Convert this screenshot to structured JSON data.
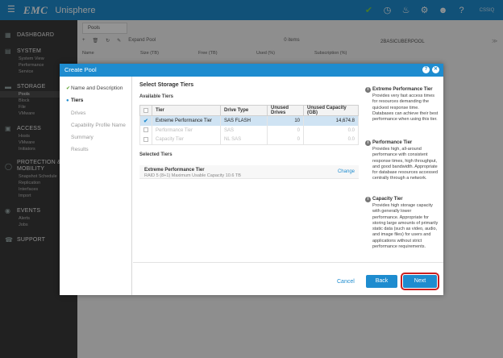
{
  "topbar": {
    "logo": "EMC",
    "product": "Unisphere",
    "brand": "CSSIQ"
  },
  "sidebar": {
    "sections": [
      {
        "label": "DASHBOARD",
        "items": []
      },
      {
        "label": "SYSTEM",
        "items": [
          "System View",
          "Performance",
          "Service"
        ]
      },
      {
        "label": "STORAGE",
        "items": [
          "Pools",
          "Block",
          "File",
          "VMware"
        ]
      },
      {
        "label": "ACCESS",
        "items": [
          "Hosts",
          "VMware",
          "Initiators"
        ]
      },
      {
        "label": "PROTECTION & MOBILITY",
        "items": [
          "Snapshot Schedule",
          "Replication",
          "Interfaces",
          "Import"
        ]
      },
      {
        "label": "EVENTS",
        "items": [
          "Alerts",
          "Jobs"
        ]
      },
      {
        "label": "SUPPORT",
        "items": []
      }
    ]
  },
  "background": {
    "tab": "Pools",
    "toolbar_action": "Expand Pool",
    "items_count": "0 items",
    "columns": [
      "Name",
      "Size (TB)",
      "Free (TB)",
      "Used (%)",
      "Subscription (%)"
    ],
    "right_panel_title": "2BASICUBERPOOL"
  },
  "dialog": {
    "title": "Create Pool",
    "steps": [
      {
        "label": "Name and Description",
        "state": "done"
      },
      {
        "label": "Tiers",
        "state": "current"
      },
      {
        "label": "Drives",
        "state": "todo"
      },
      {
        "label": "Capability Profile Name",
        "state": "todo"
      },
      {
        "label": "Summary",
        "state": "todo"
      },
      {
        "label": "Results",
        "state": "todo"
      }
    ],
    "heading": "Select Storage Tiers",
    "available_label": "Available Tiers",
    "table": {
      "headers": [
        "Tier",
        "Drive Type",
        "Unused Drives",
        "Unused Capacity (GB)"
      ],
      "rows": [
        {
          "tier": "Extreme Performance Tier",
          "drive_type": "SAS FLASH",
          "unused_drives": "10",
          "unused_capacity": "14,674.8",
          "selected": true
        },
        {
          "tier": "Performance Tier",
          "drive_type": "SAS",
          "unused_drives": "0",
          "unused_capacity": "0.0",
          "selected": false
        },
        {
          "tier": "Capacity Tier",
          "drive_type": "NL SAS",
          "unused_drives": "0",
          "unused_capacity": "0.0",
          "selected": false
        }
      ]
    },
    "selected_label": "Selected Tiers",
    "selected_tier": {
      "name": "Extreme Performance Tier",
      "detail": "RAID 5 (8+1) Maximum Usable Capacity 10.6 TB",
      "change": "Change"
    },
    "help": [
      {
        "title": "Extreme Performance Tier",
        "text": "Provides very fast access times for resources demanding the quickest response time. Databases can achieve their best performance when using this tier."
      },
      {
        "title": "Performance Tier",
        "text": "Provides high, all-around performance with consistent response times, high throughput, and good bandwidth. Appropriate for database resources accessed centrally through a network."
      },
      {
        "title": "Capacity Tier",
        "text": "Provides high storage capacity with generally lower performance. Appropriate for storing large amounts of primarily static data (such as video, audio, and image files) for users and applications without strict performance requirements."
      }
    ],
    "cancel": "Cancel",
    "back": "Back",
    "next": "Next"
  }
}
